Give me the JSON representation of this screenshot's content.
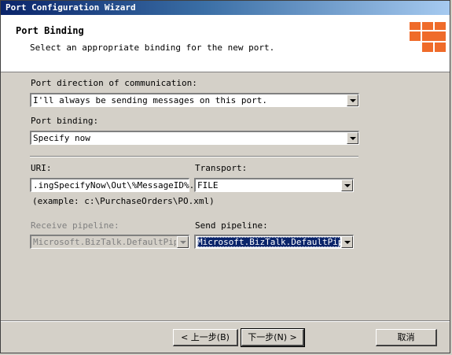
{
  "window": {
    "title": "Port Configuration Wizard"
  },
  "header": {
    "title": "Port Binding",
    "subtitle": "Select an appropriate binding for the new port.",
    "logo_color": "#ef6b2a"
  },
  "direction": {
    "label": "Port direction of communication:",
    "value": "I'll always be sending messages on this port."
  },
  "binding": {
    "label": "Port binding:",
    "value": "Specify now"
  },
  "uri": {
    "label": "URI:",
    "value": ".ingSpecifyNow\\Out\\%MessageID%.xml",
    "example": "(example: c:\\PurchaseOrders\\PO.xml)"
  },
  "transport": {
    "label": "Transport:",
    "value": "FILE"
  },
  "receive_pipeline": {
    "label": "Receive pipeline:",
    "value": "Microsoft.BizTalk.DefaultPipeli"
  },
  "send_pipeline": {
    "label": "Send pipeline:",
    "value": "Microsoft.BizTalk.DefaultPipeli"
  },
  "buttons": {
    "back": "< 上一步(B)",
    "next": "下一步(N) >",
    "cancel": "取消"
  }
}
